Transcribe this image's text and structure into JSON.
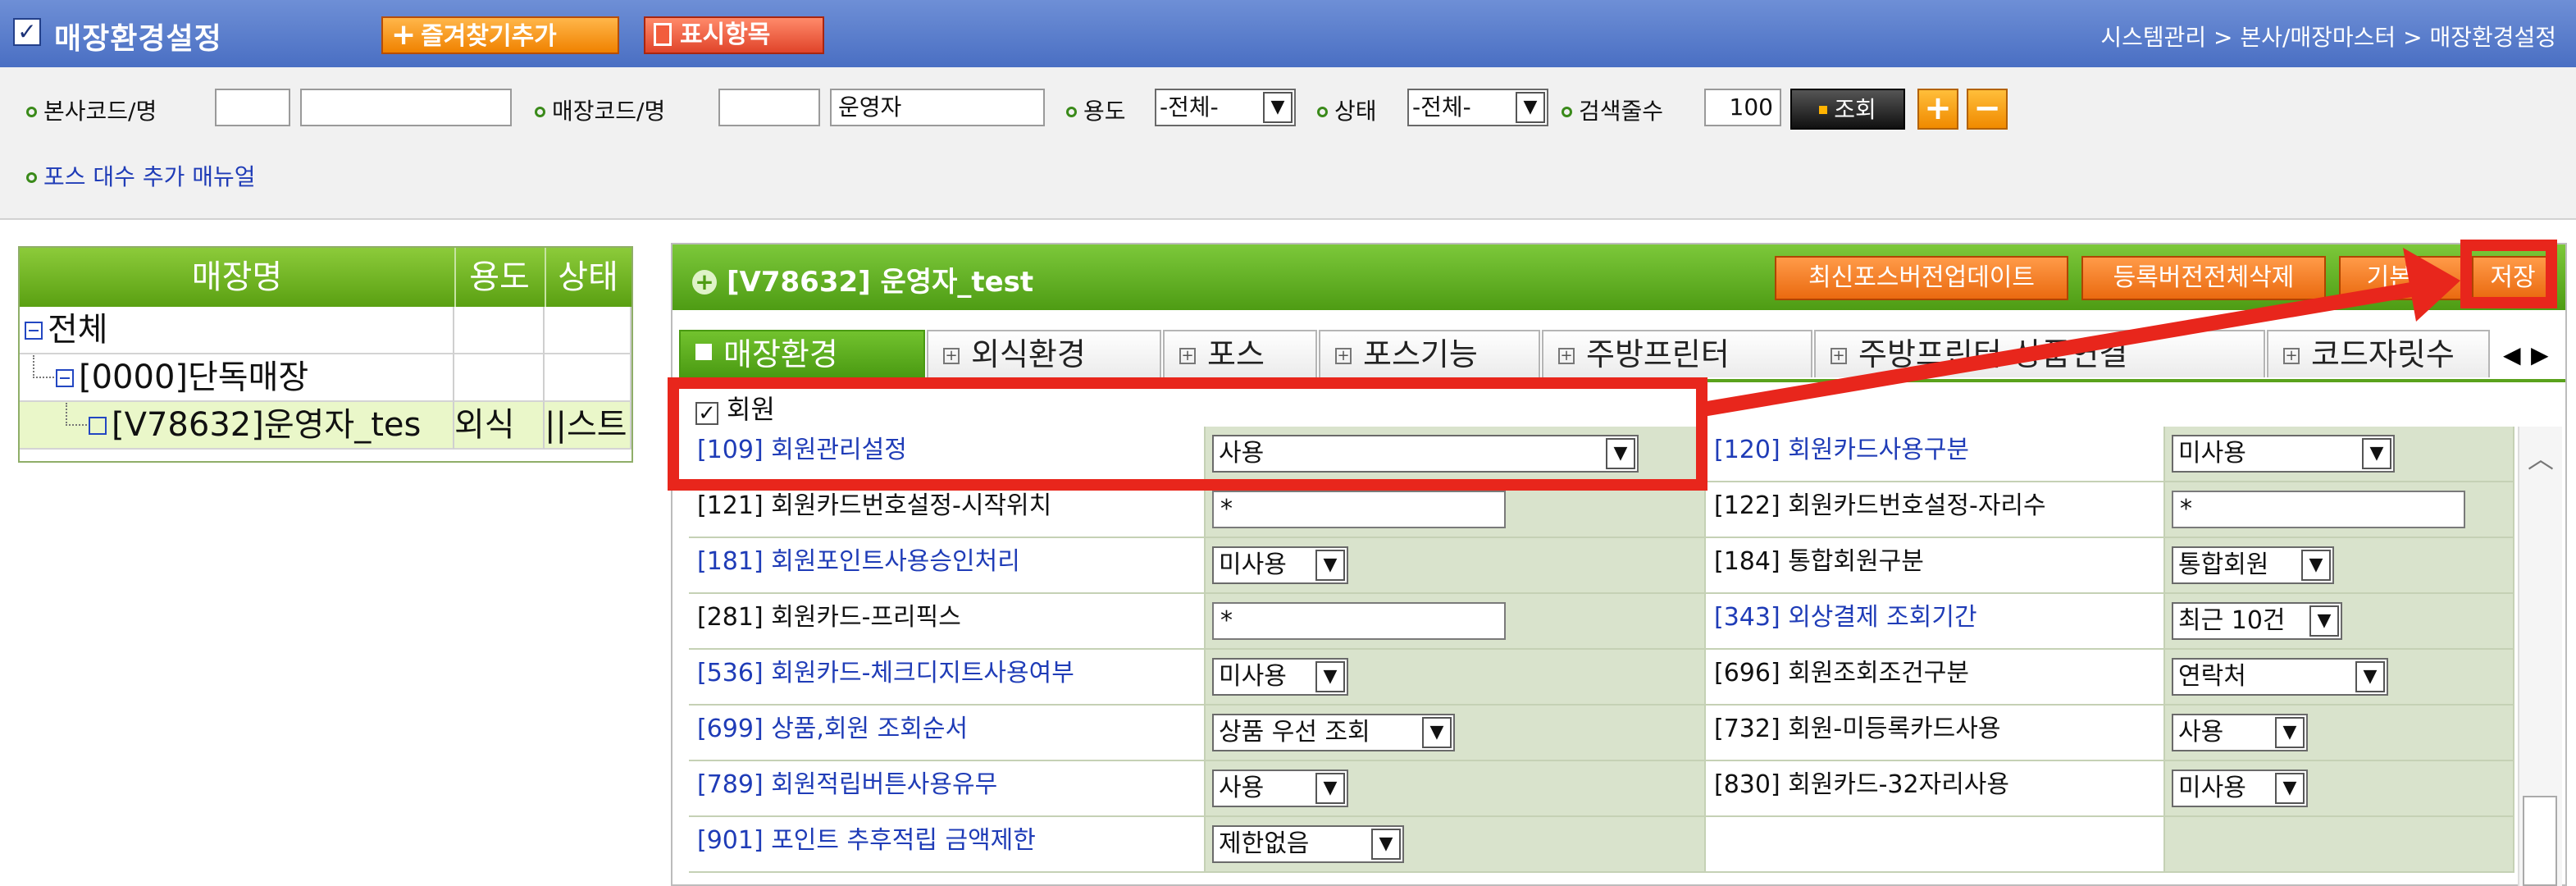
{
  "header": {
    "title": "매장환경설정",
    "fav_button": "즐겨찾기추가",
    "display_button": "표시항목",
    "breadcrumb": "시스템관리 > 본사/매장마스터 > 매장환경설정"
  },
  "filter": {
    "hq_label": "본사코드/명",
    "hq_code": "",
    "hq_name": "",
    "store_label": "매장코드/명",
    "store_code": "",
    "store_name": "운영자",
    "use_label": "용도",
    "use_value": "-전체-",
    "status_label": "상태",
    "status_value": "-전체-",
    "count_label": "검색줄수",
    "count_value": "100",
    "search_button": "조회",
    "plus_button": "+",
    "minus_button": "−",
    "manual_link": "포스 대수 추가 매뉴얼"
  },
  "tree": {
    "columns": [
      "매장명",
      "용도",
      "상태"
    ],
    "rows": [
      {
        "name": "전체",
        "use": "",
        "status": ""
      },
      {
        "name": "[0000]단독매장",
        "use": "",
        "status": ""
      },
      {
        "name": "[V78632]운영자_tes",
        "use": "외식",
        "status": "||스트"
      }
    ]
  },
  "panel": {
    "title": "[V78632] 운영자_test",
    "buttons": {
      "update_pos": "최신포스버전업데이트",
      "delete_all": "등록버전전체삭제",
      "default": "기본값",
      "save": "저장"
    },
    "tabs": [
      "매장환경",
      "외식환경",
      "포스",
      "포스기능",
      "주방프린터",
      "주방프린터-상품연결",
      "코드자릿수"
    ],
    "tab_prev": "◀",
    "tab_next": "▶",
    "section_label": "회원",
    "section_checked": "✓",
    "rows": [
      {
        "l1": "[109] 회원관리설정",
        "v1": "사용",
        "l2": "[120] 회원카드사용구분",
        "v2": "미사용"
      },
      {
        "l1": "[121] 회원카드번호설정-시작위치",
        "v1": "*",
        "l2": "[122] 회원카드번호설정-자리수",
        "v2": "*"
      },
      {
        "l1": "[181] 회원포인트사용승인처리",
        "v1": "미사용",
        "l2": "[184] 통합회원구분",
        "v2": "통합회원"
      },
      {
        "l1": "[281] 회원카드-프리픽스",
        "v1": "*",
        "l2": "[343] 외상결제 조회기간",
        "v2": "최근 10건"
      },
      {
        "l1": "[536] 회원카드-체크디지트사용여부",
        "v1": "미사용",
        "l2": "[696] 회원조회조건구분",
        "v2": "연락처"
      },
      {
        "l1": "[699] 상품,회원 조회순서",
        "v1": "상품 우선 조회",
        "l2": "[732] 회원-미등록카드사용",
        "v2": "사용"
      },
      {
        "l1": "[789] 회원적립버튼사용유무",
        "v1": "사용",
        "l2": "[830] 회원카드-32자리사용",
        "v2": "미사용"
      },
      {
        "l1": "[901] 포인트 추후적립 금액제한",
        "v1": "제한없음",
        "l2": "",
        "v2": ""
      }
    ]
  },
  "colors": {
    "accent_green": "#5aa012",
    "title_blue": "#4a6fc3",
    "annotation_red": "#e8261c",
    "link_blue": "#1f3cb7"
  }
}
